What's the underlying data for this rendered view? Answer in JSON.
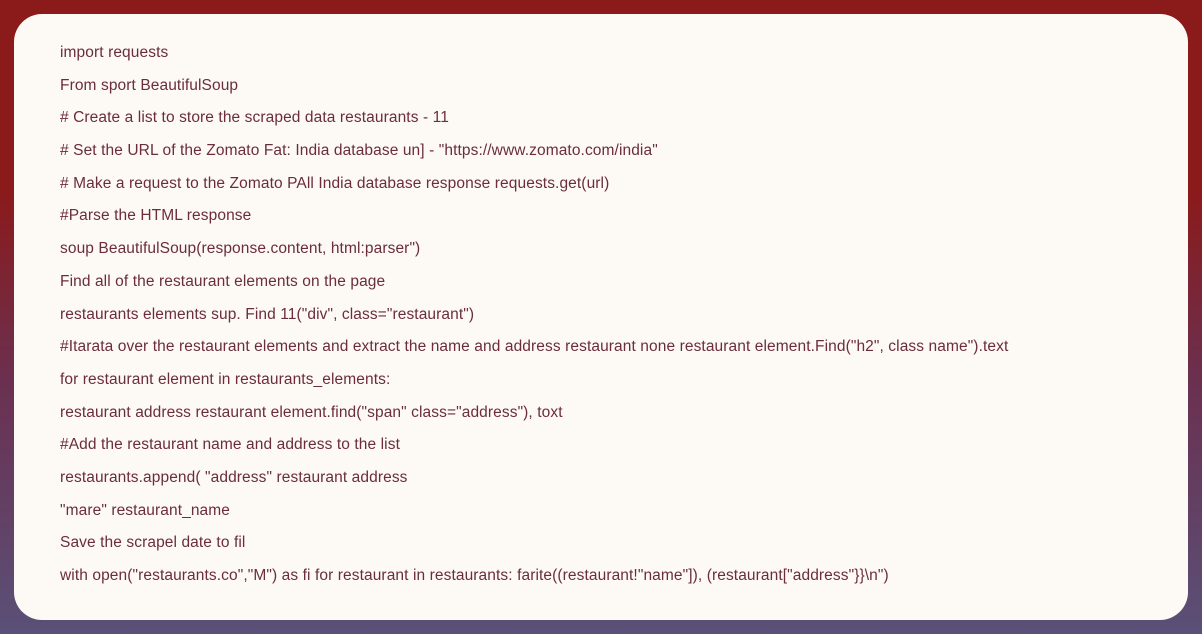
{
  "code": {
    "lines": [
      "import requests",
      "From sport BeautifulSoup",
      "# Create a list to store the scraped data restaurants - 11",
      "# Set the URL of the Zomato Fat: India database un] - \"https://www.zomato.com/india\"",
      "# Make a request to the Zomato PAll India database response requests.get(url)",
      "#Parse the HTML response",
      "soup BeautifulSoup(response.content, html:parser\")",
      "Find all of the restaurant elements on the page",
      "restaurants elements sup. Find 11(\"div\", class=\"restaurant\")",
      "#Itarata over the restaurant elements and extract the name and address restaurant none restaurant element.Find(\"h2\", class name\").text",
      "for restaurant element in restaurants_elements:",
      "restaurant address restaurant element.find(\"span\" class=\"address\"), toxt",
      "#Add the restaurant name and address to the list",
      "restaurants.append( \"address\" restaurant address",
      "\"mare\" restaurant_name",
      "Save the scrapel date to fil",
      "with open(\"restaurants.co\",\"M\") as fi for restaurant in restaurants: farite((restaurant!\"name\"]), (restaurant[\"address\"}}\\n\")"
    ]
  }
}
